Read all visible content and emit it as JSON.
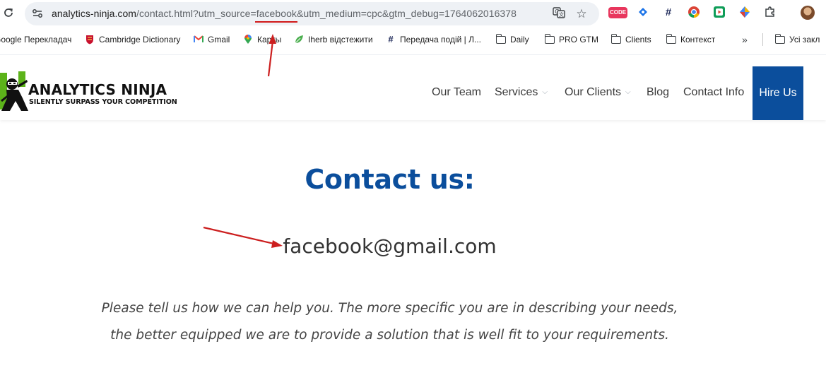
{
  "browser": {
    "url": {
      "host": "analytics-ninja.com",
      "path": "/contact.html?utm_source=",
      "highlighted": "facebook",
      "rest": "&utm_medium=cpc&gtm_debug=1764062016378"
    },
    "icons": {
      "reload": "reload-icon",
      "site_info": "site-info-icon",
      "translate": "translate-icon",
      "bookmark_star": "star-icon",
      "extensions": "puzzle-icon"
    },
    "extensions": [
      {
        "name": "code-extension",
        "label": "CODE",
        "color": "#e8365d"
      },
      {
        "name": "tag-extension",
        "label": "",
        "color": "#1a73e8"
      },
      {
        "name": "hash-extension",
        "label": "#",
        "color": "#1f2a5a"
      },
      {
        "name": "chrome-extension",
        "label": "",
        "color": "#444444"
      },
      {
        "name": "media-extension",
        "label": "",
        "color": "#0f9d58"
      },
      {
        "name": "paint-extension",
        "label": "",
        "color": "#4285f4"
      }
    ],
    "bookmarks": [
      {
        "label": "Google Перекладач",
        "icon": "translate-icon"
      },
      {
        "label": "Cambridge Dictionary",
        "icon": "crest-icon"
      },
      {
        "label": "Gmail",
        "icon": "gmail-icon"
      },
      {
        "label": "Карты",
        "icon": "maps-pin-icon"
      },
      {
        "label": "Iherb відстежити",
        "icon": "leaf-icon"
      },
      {
        "label": "Передача подій | Л...",
        "icon": "hash-icon"
      },
      {
        "label": "Daily",
        "icon": "folder-icon"
      },
      {
        "label": "PRO GTM",
        "icon": "folder-icon"
      },
      {
        "label": "Clients",
        "icon": "folder-icon"
      },
      {
        "label": "Контекст",
        "icon": "folder-icon"
      }
    ],
    "bookmarks_more": "»",
    "all_bookmarks": "Усі закл"
  },
  "site": {
    "logo": {
      "name": "ANALYTICS NINJA",
      "tagline": "SILENTLY SURPASS YOUR COMPETITION"
    },
    "nav": [
      {
        "label": "Our Team",
        "has_dropdown": false
      },
      {
        "label": "Services",
        "has_dropdown": true
      },
      {
        "label": "Our Clients",
        "has_dropdown": true
      },
      {
        "label": "Blog",
        "has_dropdown": false
      },
      {
        "label": "Contact Info",
        "has_dropdown": false
      }
    ],
    "hire_label": "Hire Us",
    "caret": "⌵",
    "accent_color": "#0b4e9c"
  },
  "content": {
    "title": "Contact us:",
    "email": "facebook@gmail.com",
    "paragraph": [
      "Please tell us how we can help you. The more specific you are in describing your needs,",
      "the better equipped we are to provide a solution that is well fit to your requirements."
    ]
  },
  "annotations": {
    "arrow_color": "#cc1f1f"
  }
}
